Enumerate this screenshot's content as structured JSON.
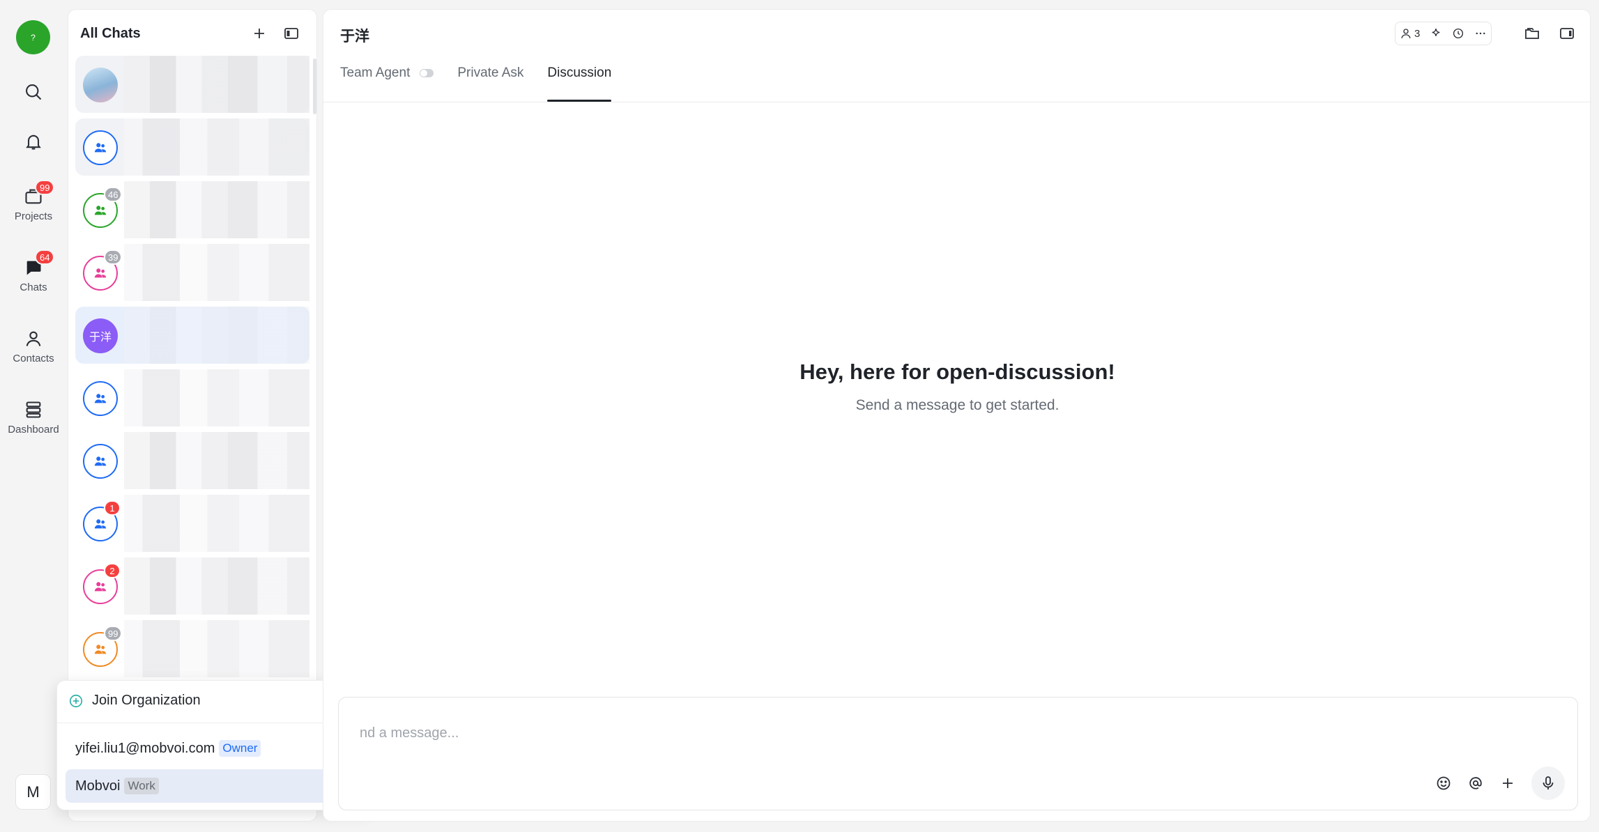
{
  "rail": {
    "logo_text": "?",
    "items": [
      {
        "name": "search",
        "label": ""
      },
      {
        "name": "notifications",
        "label": ""
      },
      {
        "name": "projects",
        "label": "Projects",
        "badge": "99"
      },
      {
        "name": "chats",
        "label": "Chats",
        "badge": "64"
      },
      {
        "name": "contacts",
        "label": "Contacts"
      },
      {
        "name": "dashboard",
        "label": "Dashboard"
      }
    ],
    "org_avatar": "M"
  },
  "chat_list": {
    "title": "All Chats",
    "rows": [
      {
        "avatar": "photo",
        "color": "#8ab4d8",
        "badge": ""
      },
      {
        "avatar": "group",
        "color": "#1f6bf5",
        "badge": ""
      },
      {
        "avatar": "group",
        "color": "#2aa52a",
        "badge": "46"
      },
      {
        "avatar": "group",
        "color": "#e83e9a",
        "badge": "39"
      },
      {
        "avatar": "text",
        "text": "于洋",
        "color": "#8b5cf6",
        "badge": ""
      },
      {
        "avatar": "group",
        "color": "#1f6bf5",
        "badge": ""
      },
      {
        "avatar": "group",
        "color": "#1f6bf5",
        "badge": ""
      },
      {
        "avatar": "group",
        "color": "#1f6bf5",
        "badge": "1"
      },
      {
        "avatar": "group",
        "color": "#e83e9a",
        "badge": "2"
      },
      {
        "avatar": "group",
        "color": "#f08a24",
        "badge": "99"
      }
    ]
  },
  "org_menu": {
    "join_label": "Join Organization",
    "orgs": [
      {
        "name": "yifei.liu1@mobvoi.com",
        "tag": "Owner"
      },
      {
        "name": "Mobvoi",
        "tag": "Work"
      }
    ]
  },
  "main": {
    "title": "于洋",
    "member_count": "3",
    "tabs": [
      {
        "label": "Team Agent"
      },
      {
        "label": "Private Ask"
      },
      {
        "label": "Discussion"
      }
    ],
    "hero_title": "Hey, here for open-discussion!",
    "hero_sub": "Send a message to get started.",
    "composer_placeholder": "nd a message..."
  },
  "colors": {
    "accent": "#1f6bf5",
    "badge_red": "#f53f3f",
    "badge_gray": "#a8abb2"
  }
}
